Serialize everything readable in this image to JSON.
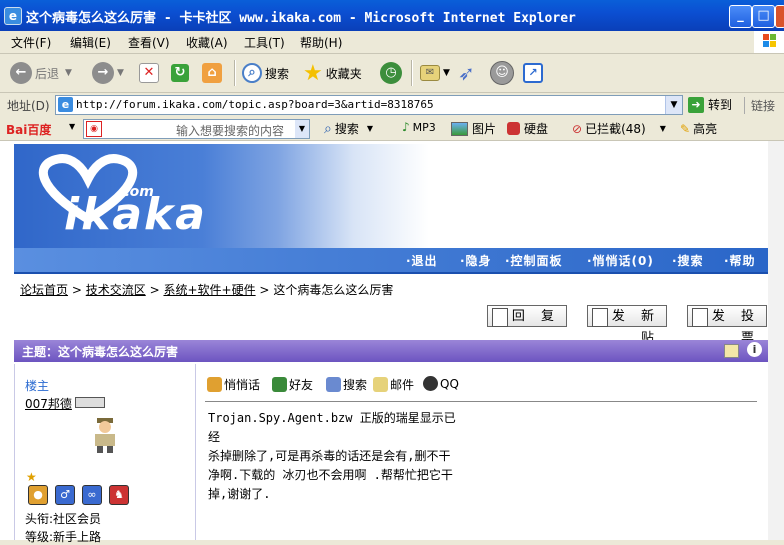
{
  "window": {
    "title": "这个病毒怎么这么厉害 - 卡卡社区 www.ikaka.com - Microsoft Internet Explorer",
    "min": "_",
    "max": "□",
    "close": "✕"
  },
  "menu": [
    "文件(F)",
    "编辑(E)",
    "查看(V)",
    "收藏(A)",
    "工具(T)",
    "帮助(H)"
  ],
  "toolbar": {
    "back": "后退",
    "search": "搜索",
    "favorites": "收藏夹"
  },
  "address": {
    "label": "地址(D)",
    "url": "http://forum.ikaka.com/topic.asp?board=3&artid=8318765",
    "go": "转到",
    "links": "链接"
  },
  "baidubar": {
    "logo": "Bai百度",
    "placeholder": "输入想要搜索的内容",
    "search": "搜索",
    "mp3": "MP3",
    "image": "图片",
    "drive": "硬盘",
    "blocked": "已拦截(48)",
    "highlight": "高亮"
  },
  "banner": {
    "logo": "ikaka",
    "com": ".com"
  },
  "nav": [
    "·退出",
    "·隐身",
    "·控制面板",
    "·悄悄话(0)",
    "·搜索",
    "·帮助"
  ],
  "breadcrumb": {
    "home": "论坛首页",
    "c1": "技术交流区",
    "c2": "系统+软件+硬件",
    "current": "这个病毒怎么这么厉害",
    "sep": ">"
  },
  "buttons": {
    "reply": "回 复",
    "newpost": "发 新 贴",
    "vote": "发 投 票"
  },
  "topic": {
    "label": "主题：这个病毒怎么这么厉害"
  },
  "author": {
    "role": "楼主",
    "name": "007邦德",
    "title": "头衔:社区会员",
    "level": "等级:新手上路"
  },
  "actions": [
    "悄悄话",
    "好友",
    "搜索",
    "邮件",
    "QQ"
  ],
  "post": {
    "lines": [
      "Trojan.Spy.Agent.bzw 正版的瑞星显示已经",
      "杀掉删除了,可是再杀毒的话还是会有,删不干",
      "净啊.下载的 冰刃也不会用啊 .帮帮忙把它干",
      "掉,谢谢了."
    ]
  }
}
